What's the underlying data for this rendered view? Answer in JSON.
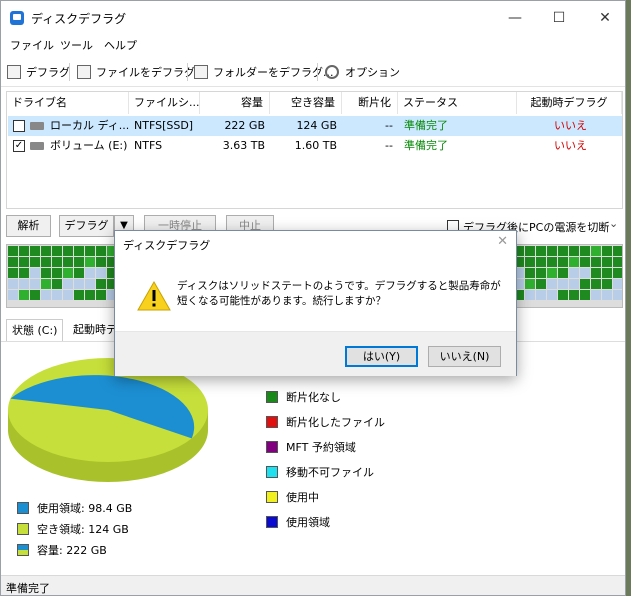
{
  "window": {
    "title": "ディスクデフラグ"
  },
  "menu": [
    "ファイル",
    "ツール",
    "ヘルプ"
  ],
  "toolbar": {
    "defrag": "デフラグ",
    "defrag_file": "ファイルをデフラグ...",
    "defrag_folder": "フォルダーをデフラグ...",
    "options": "オプション"
  },
  "table": {
    "headers": [
      "ドライブ名",
      "ファイルシ...",
      "容量",
      "空き容量",
      "断片化",
      "ステータス",
      "起動時デフラグ"
    ],
    "rows": [
      {
        "checked": false,
        "name": "ローカル ディ...",
        "fs": "NTFS[SSD]",
        "capacity": "222 GB",
        "free": "124 GB",
        "frag": "--",
        "status": "準備完了",
        "boot": "いいえ"
      },
      {
        "checked": true,
        "name": "ボリューム (E:)",
        "fs": "NTFS",
        "capacity": "3.63 TB",
        "free": "1.60 TB",
        "frag": "--",
        "status": "準備完了",
        "boot": "いいえ"
      }
    ]
  },
  "actions": {
    "analyze": "解析",
    "defrag": "デフラグ",
    "pause": "一時停止",
    "stop": "中止",
    "shutdown_label": "デフラグ後にPCの電源を切断"
  },
  "tabs": [
    "状態 (C:)",
    "起動時デ"
  ],
  "pie_legend": [
    {
      "label": "使用領域: 98.4 GB",
      "color": "#1c8fd3"
    },
    {
      "label": "空き領域: 124 GB",
      "color": "#c6df3a"
    },
    {
      "label": "容量: 222 GB",
      "color": "#c6df3a"
    }
  ],
  "pie": {
    "used_fraction": 0.443
  },
  "map_legend": [
    {
      "label": "断片化なし",
      "color": "#1a8a1a"
    },
    {
      "label": "断片化したファイル",
      "color": "#e01010"
    },
    {
      "label": "MFT 予約領域",
      "color": "#800080"
    },
    {
      "label": "移動不可ファイル",
      "color": "#20e0f0"
    },
    {
      "label": "使用中",
      "color": "#f0f020"
    },
    {
      "label": "使用領域",
      "color": "#0a0ad0"
    }
  ],
  "status": "準備完了",
  "dialog": {
    "title": "ディスクデフラグ",
    "message": "ディスクはソリッドステートのようです。デフラグすると製品寿命が短くなる可能性があります。続行しますか？",
    "yes": "はい(Y)",
    "no": "いいえ(N)"
  }
}
